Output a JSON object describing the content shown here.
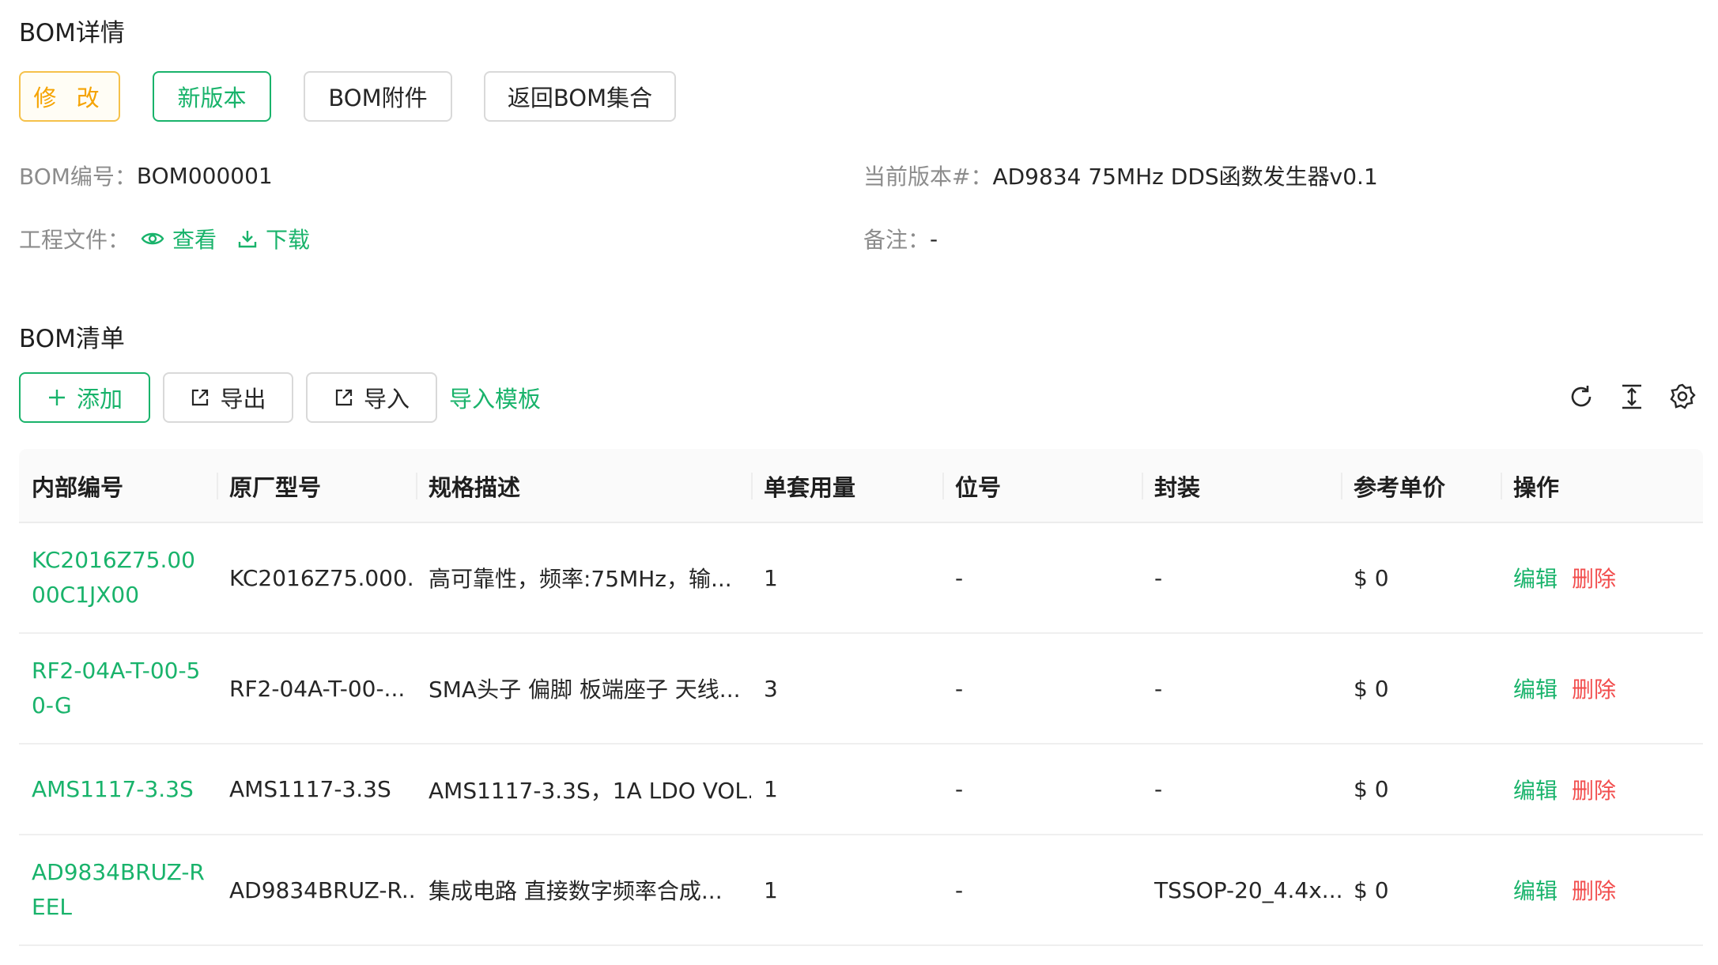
{
  "detail": {
    "title": "BOM详情",
    "buttons": {
      "edit": "修 改",
      "new_version": "新版本",
      "attachment": "BOM附件",
      "back": "返回BOM集合"
    },
    "bom_no_label": "BOM编号：",
    "bom_no_value": "BOM000001",
    "version_label": "当前版本#：",
    "version_value": "AD9834 75MHz DDS函数发生器v0.1",
    "file_label": "工程文件：",
    "file_view": "查看",
    "file_download": "下载",
    "note_label": "备注：",
    "note_value": "-"
  },
  "list": {
    "title": "BOM清单",
    "add": "添加",
    "export": "导出",
    "import": "导入",
    "template": "导入模板",
    "columns": [
      "内部编号",
      "原厂型号",
      "规格描述",
      "单套用量",
      "位号",
      "封装",
      "参考单价",
      "操作"
    ],
    "edit_label": "编辑",
    "delete_label": "删除",
    "rows": [
      {
        "internal": "KC2016Z75.0000C1JX00",
        "model": "KC2016Z75.000...",
        "spec": "高可靠性，频率:75MHz，输...",
        "qty": "1",
        "ref": "-",
        "package": "-",
        "price": "$ 0"
      },
      {
        "internal": "RF2-04A-T-00-50-G",
        "model": "RF2-04A-T-00-...",
        "spec": "SMA头子 偏脚 板端座子 天线...",
        "qty": "3",
        "ref": "-",
        "package": "-",
        "price": "$ 0"
      },
      {
        "internal": "AMS1117-3.3S",
        "model": "AMS1117-3.3S",
        "spec": "AMS1117-3.3S，1A LDO VOL...",
        "qty": "1",
        "ref": "-",
        "package": "-",
        "price": "$ 0"
      },
      {
        "internal": "AD9834BRUZ-REEL",
        "model": "AD9834BRUZ-R...",
        "spec": "集成电路 直接数字频率合成...",
        "qty": "1",
        "ref": "-",
        "package": "TSSOP-20_4.4x...",
        "price": "$ 0"
      }
    ]
  },
  "colors": {
    "accent": "#19b36b",
    "warn": "#f5a300",
    "danger": "#f24e4e"
  }
}
